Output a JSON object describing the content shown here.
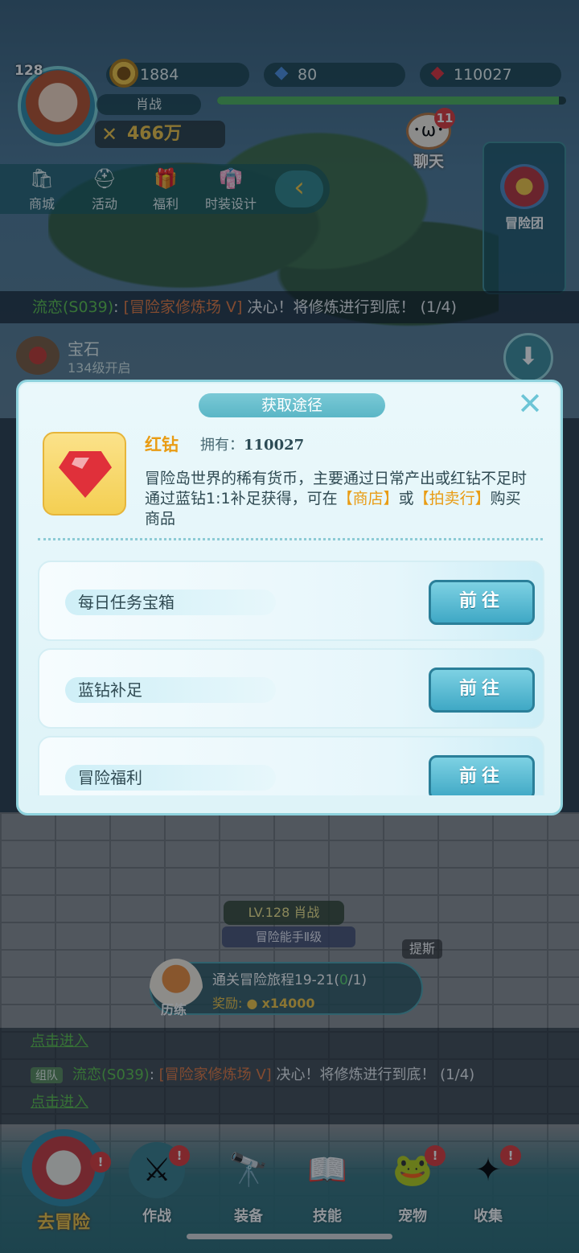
{
  "hud": {
    "level": "128",
    "player_name": "肖战",
    "power": "466万",
    "gold": "1884",
    "blue_diamond": "80",
    "red_diamond": "110027",
    "chat_label": "聊天",
    "chat_badge": "11",
    "exp_fraction": 0.98
  },
  "menu": {
    "items": [
      {
        "label": "商城",
        "icon": "bag-icon"
      },
      {
        "label": "活动",
        "icon": "helmet-icon"
      },
      {
        "label": "福利",
        "icon": "gift-icon"
      },
      {
        "label": "时装设计",
        "icon": "outfit-icon"
      }
    ],
    "collapse_glyph": "‹"
  },
  "side_panel": {
    "label": "冒险团"
  },
  "notice": {
    "who": "流恋(S039)",
    "colon": ": ",
    "where": "[冒险家修炼场 V]",
    "message": " 决心！将修炼进行到底！ (1/4)"
  },
  "gem_unlock": {
    "title": "宝石",
    "subtitle": "134级开启"
  },
  "dialog": {
    "title": "获取途径",
    "close_glyph": "✕",
    "item_name": "红钻",
    "own_label": "拥有：",
    "own_value": "110027",
    "desc_parts": [
      "冒险岛世界的稀有货币，主要通过日常产出或红钻不足时通过蓝钻1:1补足获得，可在",
      "【商店】",
      "或",
      "【拍卖行】",
      "购买商品"
    ],
    "ways": [
      {
        "label": "每日任务宝箱",
        "button": "前往"
      },
      {
        "label": "蓝钻补足",
        "button": "前往"
      },
      {
        "label": "冒险福利",
        "button": "前往"
      }
    ]
  },
  "scene": {
    "char_level": "LV.128 肖战",
    "char_title": "冒险能手Ⅱ级",
    "npc_name": "提斯",
    "quest_label": "历练",
    "quest_title": "通关冒险旅程19-21(",
    "quest_count": "0",
    "quest_total": "/1)",
    "quest_reward_label": "奖励:",
    "quest_reward_amount": "x14000"
  },
  "chatlog": {
    "tag": "组队",
    "line1_who": "流恋(S039)",
    "line1_where": "[冒险家修炼场 V]",
    "line1_msg": " 决心！将修炼进行到底！ (1/4)",
    "line1_link": "点击进入",
    "line0_link": "点击进入"
  },
  "bottom_nav": {
    "adventure": "去冒险",
    "items": [
      {
        "label": "作战",
        "icon": "battle-icon"
      },
      {
        "label": "装备",
        "icon": "cannon-icon"
      },
      {
        "label": "技能",
        "icon": "skill-icon"
      },
      {
        "label": "宠物",
        "icon": "pet-icon"
      },
      {
        "label": "收集",
        "icon": "collect-icon"
      }
    ]
  },
  "colors": {
    "accent": "#e99c14",
    "button": "#3fa8c5",
    "badge": "#e03a3a"
  }
}
